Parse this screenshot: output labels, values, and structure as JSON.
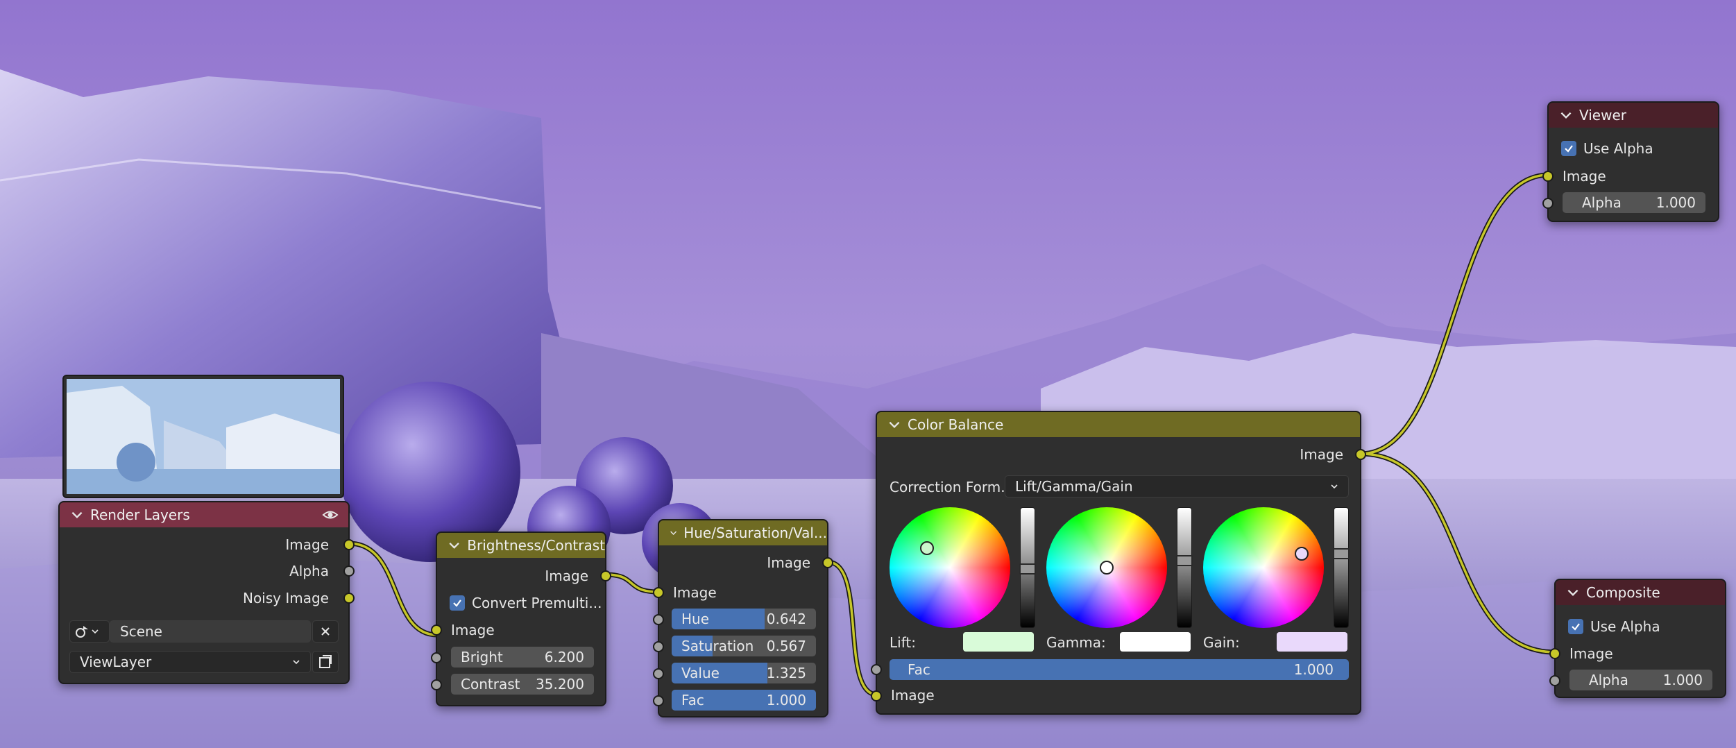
{
  "render_layers": {
    "title": "Render Layers",
    "outputs": [
      "Image",
      "Alpha",
      "Noisy Image"
    ],
    "scene": "Scene",
    "view_layer": "ViewLayer"
  },
  "brightness_contrast": {
    "title": "Brightness/Contrast",
    "output": "Image",
    "convert_label": "Convert Premulti...",
    "input_image": "Image",
    "bright_label": "Bright",
    "bright_value": "6.200",
    "contrast_label": "Contrast",
    "contrast_value": "35.200"
  },
  "hue_sat": {
    "title": "Hue/Saturation/Val...",
    "output": "Image",
    "input_image": "Image",
    "hue_label": "Hue",
    "hue_value": "0.642",
    "hue_fraction": 0.642,
    "sat_label": "Saturation",
    "sat_value": "0.567",
    "sat_fraction": 0.2835,
    "val_label": "Value",
    "val_value": "1.325",
    "val_fraction": 0.6625,
    "fac_label": "Fac",
    "fac_value": "1.000",
    "fac_fraction": 1.0
  },
  "color_balance": {
    "title": "Color Balance",
    "output": "Image",
    "correction_label": "Correction Form...",
    "correction_value": "Lift/Gamma/Gain",
    "lift_label": "Lift:",
    "gamma_label": "Gamma:",
    "gain_label": "Gain:",
    "lift_color": "#d9fbd9",
    "gamma_color": "#ffffff",
    "gain_color": "#e9d9fb",
    "fac_label": "Fac",
    "fac_value": "1.000",
    "input_image": "Image"
  },
  "viewer": {
    "title": "Viewer",
    "use_alpha_label": "Use Alpha",
    "input_image": "Image",
    "alpha_label": "Alpha",
    "alpha_value": "1.000"
  },
  "composite": {
    "title": "Composite",
    "use_alpha_label": "Use Alpha",
    "input_image": "Image",
    "alpha_label": "Alpha",
    "alpha_value": "1.000"
  },
  "colors": {
    "header_input": "#7c3245",
    "header_color": "#6f6b23",
    "header_output": "#4a2029",
    "socket_color": "#c7c729",
    "socket_float": "#a1a1a1",
    "slider_fill": "#4772b3",
    "link": "#c7c729"
  }
}
